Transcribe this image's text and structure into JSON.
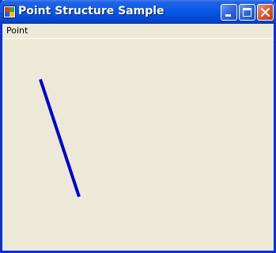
{
  "window": {
    "title": "Point Structure Sample",
    "controls": {
      "minimize_icon": "minimize-icon",
      "maximize_icon": "maximize-icon",
      "close_icon": "close-icon"
    }
  },
  "menu": {
    "items": [
      {
        "label": "Point"
      }
    ]
  },
  "canvas": {
    "line_color": "#0000D0",
    "background": "#ECE9D8"
  },
  "colors": {
    "titlebar": "#0553E0",
    "frame": "#0831D9",
    "close_button": "#D9542D"
  }
}
